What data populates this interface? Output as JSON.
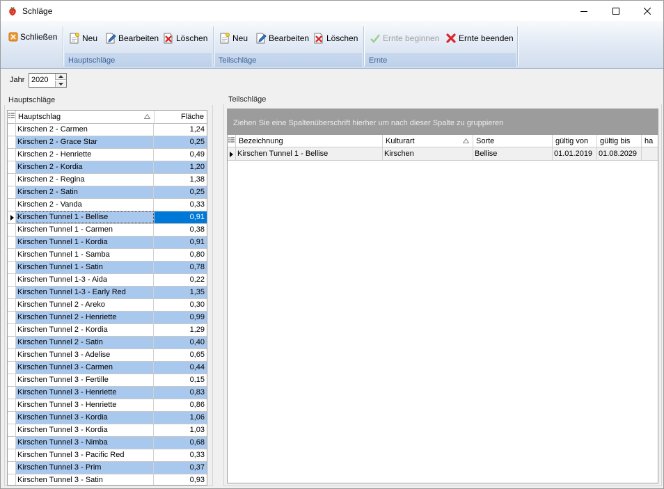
{
  "window": {
    "title": "Schläge",
    "controls": {
      "minimize": "minimize-icon",
      "maximize": "maximize-icon",
      "close": "close-icon"
    }
  },
  "ribbon": {
    "close_label": "Schließen",
    "groups": [
      {
        "caption": "Hauptschläge",
        "buttons": {
          "new": "Neu",
          "edit": "Bearbeiten",
          "delete": "Löschen"
        }
      },
      {
        "caption": "Teilschläge",
        "buttons": {
          "new": "Neu",
          "edit": "Bearbeiten",
          "delete": "Löschen"
        }
      },
      {
        "caption": "Ernte",
        "buttons": {
          "start": "Ernte beginnen",
          "end": "Ernte beenden"
        }
      }
    ]
  },
  "jahr": {
    "label": "Jahr",
    "value": "2020"
  },
  "hauptschlaege": {
    "title": "Hauptschläge",
    "columns": {
      "name": "Hauptschlag",
      "area": "Fläche"
    },
    "selected_index": 7,
    "rows": [
      {
        "name": "Kirschen 2 - Carmen",
        "area": "1,24"
      },
      {
        "name": "Kirschen 2 - Grace Star",
        "area": "0,25"
      },
      {
        "name": "Kirschen 2 - Henriette",
        "area": "0,49"
      },
      {
        "name": "Kirschen 2 - Kordia",
        "area": "1,20"
      },
      {
        "name": "Kirschen 2 - Regina",
        "area": "1,38"
      },
      {
        "name": "Kirschen 2 - Satin",
        "area": "0,25"
      },
      {
        "name": "Kirschen 2 - Vanda",
        "area": "0,33"
      },
      {
        "name": "Kirschen Tunnel 1 - Bellise",
        "area": "0,91"
      },
      {
        "name": "Kirschen Tunnel 1 - Carmen",
        "area": "0,38"
      },
      {
        "name": "Kirschen Tunnel 1 - Kordia",
        "area": "0,91"
      },
      {
        "name": "Kirschen Tunnel 1 - Samba",
        "area": "0,80"
      },
      {
        "name": "Kirschen Tunnel 1 - Satin",
        "area": "0,78"
      },
      {
        "name": "Kirschen Tunnel 1-3 - Aida",
        "area": "0,22"
      },
      {
        "name": "Kirschen Tunnel 1-3 - Early Red",
        "area": "1,35"
      },
      {
        "name": "Kirschen Tunnel 2 - Areko",
        "area": "0,30"
      },
      {
        "name": "Kirschen Tunnel 2 - Henriette",
        "area": "0,99"
      },
      {
        "name": "Kirschen Tunnel 2 - Kordia",
        "area": "1,29"
      },
      {
        "name": "Kirschen Tunnel 2 - Satin",
        "area": "0,40"
      },
      {
        "name": "Kirschen Tunnel 3 - Adelise",
        "area": "0,65"
      },
      {
        "name": "Kirschen Tunnel 3 - Carmen",
        "area": "0,44"
      },
      {
        "name": "Kirschen Tunnel 3 - Fertille",
        "area": "0,15"
      },
      {
        "name": "Kirschen Tunnel 3 - Henriette",
        "area": "0,83"
      },
      {
        "name": "Kirschen Tunnel 3 - Henriette",
        "area": "0,86"
      },
      {
        "name": "Kirschen Tunnel 3 - Kordia",
        "area": "1,06"
      },
      {
        "name": "Kirschen Tunnel 3 - Kordia",
        "area": "1,03"
      },
      {
        "name": "Kirschen Tunnel 3 - Nimba",
        "area": "0,68"
      },
      {
        "name": "Kirschen Tunnel 3 - Pacific Red",
        "area": "0,33"
      },
      {
        "name": "Kirschen Tunnel 3 - Prim",
        "area": "0,37"
      },
      {
        "name": "Kirschen Tunnel 3 - Satin",
        "area": "0,93"
      }
    ]
  },
  "teilschlaege": {
    "title": "Teilschläge",
    "group_hint": "Ziehen Sie eine Spaltenüberschrift hierher um nach dieser Spalte zu gruppieren",
    "columns": {
      "name": "Bezeichnung",
      "kulturart": "Kulturart",
      "sorte": "Sorte",
      "von": "gültig von",
      "bis": "gültig bis",
      "ha": "ha"
    },
    "rows": [
      {
        "name": "Kirschen Tunnel 1 - Bellise",
        "kulturart": "Kirschen",
        "sorte": "Bellise",
        "von": "01.01.2019",
        "bis": "01.08.2029",
        "ha": ""
      }
    ]
  },
  "colors": {
    "row_alt": "#a9c8ee",
    "selection": "#0078d7",
    "ribbon_caption": "#3b5f95"
  }
}
